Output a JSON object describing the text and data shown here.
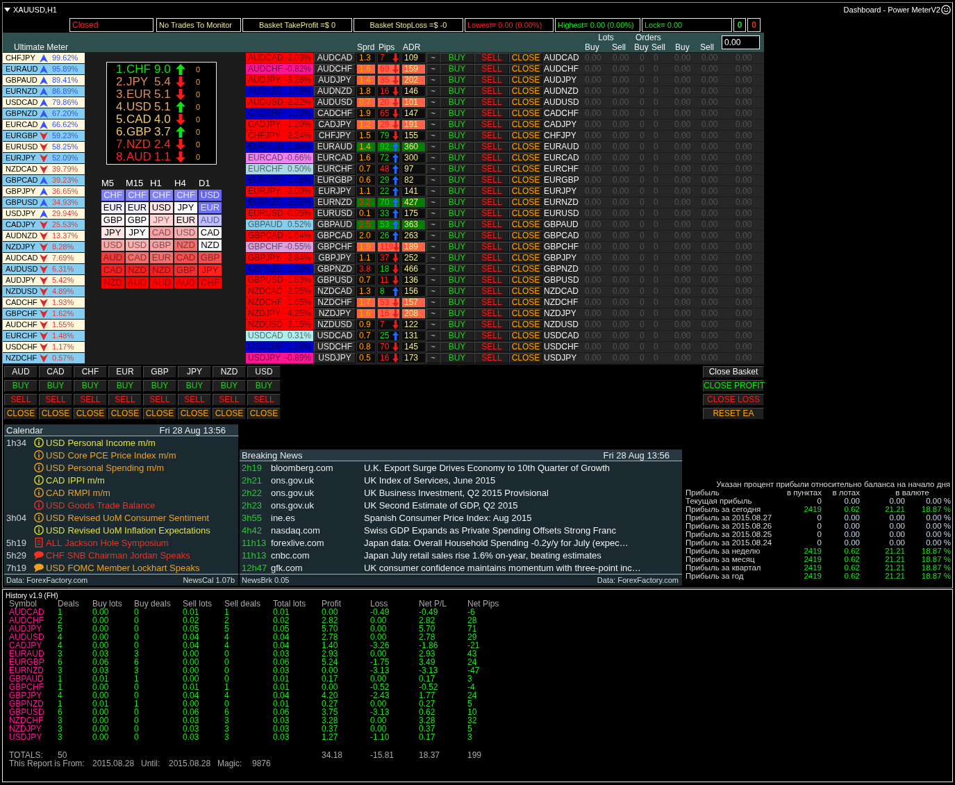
{
  "window": {
    "title": "XAUUSD,H1",
    "indicator": "Dashboard - Power MeterV2"
  },
  "status_boxes": [
    {
      "text": "Closed",
      "color": "#ff2020"
    },
    {
      "text": "No Trades To Monitor",
      "color": "#f0e68c"
    },
    {
      "text": "Basket TakeProfit =$ 0",
      "color": "#f0e68c"
    },
    {
      "text": "Basket StopLoss =$ -0",
      "color": "#f0e68c"
    },
    {
      "text": "Lowest= 0.00 (0.00%)",
      "color": "#ff2020"
    },
    {
      "text": "Highest= 0.00 (0.00%)",
      "color": "#20e020"
    },
    {
      "text": "Lock= 0.00",
      "color": "#20e020"
    },
    {
      "text": "0",
      "color": "#20e020"
    },
    {
      "text": "0",
      "color": "#ff2020"
    }
  ],
  "header": {
    "title": "Ultimate Meter",
    "columns": [
      "Sprd",
      "Pips",
      "ADR"
    ],
    "groups": [
      {
        "label": "Lots",
        "sub": [
          "Buy",
          "Sell"
        ]
      },
      {
        "label": "Orders",
        "sub": [
          "Buy",
          "Sell"
        ]
      }
    ],
    "extra": [
      "Buy",
      "Sell"
    ],
    "amount": "0.00"
  },
  "meter": [
    {
      "pair": "CHFJPY",
      "rising": true,
      "percent": "99.62%",
      "bullish": true
    },
    {
      "pair": "EURAUD",
      "rising": true,
      "percent": "95.89%",
      "bullish": true
    },
    {
      "pair": "GBPAUD",
      "rising": true,
      "percent": "89.41%",
      "bullish": true
    },
    {
      "pair": "EURNZD",
      "rising": true,
      "percent": "86.89%",
      "bullish": true
    },
    {
      "pair": "USDCAD",
      "rising": true,
      "percent": "79.86%",
      "bullish": true
    },
    {
      "pair": "GBPNZD",
      "rising": true,
      "percent": "67.20%",
      "bullish": true
    },
    {
      "pair": "EURCAD",
      "rising": true,
      "percent": "66.62%",
      "bullish": true
    },
    {
      "pair": "EURGBP",
      "rising": false,
      "percent": "59.23%",
      "bullish": true
    },
    {
      "pair": "EURUSD",
      "rising": false,
      "percent": "58.25%",
      "bullish": true
    },
    {
      "pair": "EURJPY",
      "rising": false,
      "percent": "52.09%",
      "bullish": true
    },
    {
      "pair": "NZDCAD",
      "rising": false,
      "percent": "39.79%",
      "bullish": false
    },
    {
      "pair": "GBPCAD",
      "rising": true,
      "percent": "39.23%",
      "bullish": false
    },
    {
      "pair": "GBPJPY",
      "rising": true,
      "percent": "36.65%",
      "bullish": false
    },
    {
      "pair": "GBPUSD",
      "rising": true,
      "percent": "34.93%",
      "bullish": false
    },
    {
      "pair": "USDJPY",
      "rising": true,
      "percent": "29.94%",
      "bullish": false
    },
    {
      "pair": "CADJPY",
      "rising": false,
      "percent": "25.53%",
      "bullish": false
    },
    {
      "pair": "AUDNZD",
      "rising": false,
      "percent": "13.37%",
      "bullish": false
    },
    {
      "pair": "NZDJPY",
      "rising": false,
      "percent": "8.28%",
      "bullish": false
    },
    {
      "pair": "AUDCAD",
      "rising": false,
      "percent": "7.69%",
      "bullish": false
    },
    {
      "pair": "AUDUSD",
      "rising": false,
      "percent": "6.31%",
      "bullish": false
    },
    {
      "pair": "AUDJPY",
      "rising": false,
      "percent": "5.42%",
      "bullish": false
    },
    {
      "pair": "NZDUSD",
      "rising": false,
      "percent": "4.89%",
      "bullish": false
    },
    {
      "pair": "CADCHF",
      "rising": false,
      "percent": "1.93%",
      "bullish": false
    },
    {
      "pair": "GBPCHF",
      "rising": false,
      "percent": "1.62%",
      "bullish": false
    },
    {
      "pair": "AUDCHF",
      "rising": false,
      "percent": "1.55%",
      "bullish": false
    },
    {
      "pair": "EURCHF",
      "rising": false,
      "percent": "1.48%",
      "bullish": false
    },
    {
      "pair": "USDCHF",
      "rising": false,
      "percent": "1.17%",
      "bullish": false
    },
    {
      "pair": "NZDCHF",
      "rising": false,
      "percent": "0.57%",
      "bullish": false
    }
  ],
  "strength": [
    {
      "rank": "1.",
      "currency": "CHF",
      "score": "9.0",
      "rising": true,
      "count": "0",
      "color": "#12e012"
    },
    {
      "rank": "2.",
      "currency": "JPY",
      "score": "5.4",
      "rising": false,
      "count": "0",
      "color": "#e08a50"
    },
    {
      "rank": "3.",
      "currency": "EUR",
      "score": "5.1",
      "rising": false,
      "count": "0",
      "color": "#e08a50"
    },
    {
      "rank": "4.",
      "currency": "USD",
      "score": "5.1",
      "rising": true,
      "count": "0",
      "color": "#e8a860"
    },
    {
      "rank": "5.",
      "currency": "CAD",
      "score": "4.0",
      "rising": false,
      "count": "0",
      "color": "#f0c860"
    },
    {
      "rank": "6.",
      "currency": "GBP",
      "score": "3.7",
      "rising": true,
      "count": "0",
      "color": "#f0c860"
    },
    {
      "rank": "7.",
      "currency": "NZD",
      "score": "2.4",
      "rising": false,
      "count": "0",
      "color": "#e83a10"
    },
    {
      "rank": "8.",
      "currency": "AUD",
      "score": "1.1",
      "rising": false,
      "count": "0",
      "color": "#ff2020"
    }
  ],
  "timeframes": [
    {
      "label": "M5",
      "cells": [
        {
          "currency": "CHF",
          "color": "#8080ff"
        },
        {
          "currency": "EUR",
          "color": "#f0f0ff"
        },
        {
          "currency": "GBP",
          "color": "#fff4f4"
        },
        {
          "currency": "JPY",
          "color": "#ffe4e4"
        },
        {
          "currency": "USD",
          "color": "#f4a8a8"
        },
        {
          "currency": "AUD",
          "color": "#ee3c3c"
        },
        {
          "currency": "CAD",
          "color": "#f42020"
        },
        {
          "currency": "NZD",
          "color": "#ff0000"
        }
      ]
    },
    {
      "label": "M15",
      "cells": [
        {
          "currency": "CHF",
          "color": "#8080ff"
        },
        {
          "currency": "EUR",
          "color": "#eef0ff"
        },
        {
          "currency": "GBP",
          "color": "#ffffff"
        },
        {
          "currency": "JPY",
          "color": "#fffafa"
        },
        {
          "currency": "USD",
          "color": "#f4b4b4"
        },
        {
          "currency": "CAD",
          "color": "#f07070"
        },
        {
          "currency": "NZD",
          "color": "#f42020"
        },
        {
          "currency": "AUD",
          "color": "#ff0000"
        }
      ]
    },
    {
      "label": "H1",
      "cells": [
        {
          "currency": "CHF",
          "color": "#8080ff"
        },
        {
          "currency": "USD",
          "color": "#ffe4e4"
        },
        {
          "currency": "JPY",
          "color": "#ffd4d4"
        },
        {
          "currency": "CAD",
          "color": "#f4a4a4"
        },
        {
          "currency": "GBP",
          "color": "#f4a4a4"
        },
        {
          "currency": "EUR",
          "color": "#f07070"
        },
        {
          "currency": "NZD",
          "color": "#f42020"
        },
        {
          "currency": "AUD",
          "color": "#ff0000"
        }
      ]
    },
    {
      "label": "H4",
      "cells": [
        {
          "currency": "CHF",
          "color": "#8080ff"
        },
        {
          "currency": "JPY",
          "color": "#ffffff"
        },
        {
          "currency": "EUR",
          "color": "#ffe4e4"
        },
        {
          "currency": "USD",
          "color": "#f4b0b0"
        },
        {
          "currency": "NZD",
          "color": "#f07070"
        },
        {
          "currency": "CAD",
          "color": "#f05050"
        },
        {
          "currency": "GBP",
          "color": "#f03030"
        },
        {
          "currency": "AUD",
          "color": "#ff0000"
        }
      ]
    },
    {
      "label": "D1",
      "cells": [
        {
          "currency": "USD",
          "color": "#6464ff"
        },
        {
          "currency": "EUR",
          "color": "#7070ff"
        },
        {
          "currency": "AUD",
          "color": "#c0c0ff"
        },
        {
          "currency": "CAD",
          "color": "#ffffff"
        },
        {
          "currency": "NZD",
          "color": "#f8f8ff"
        },
        {
          "currency": "GBP",
          "color": "#f05050"
        },
        {
          "currency": "JPY",
          "color": "#ff2020"
        },
        {
          "currency": "CHF",
          "color": "#ff0000"
        }
      ]
    }
  ],
  "pairs": [
    {
      "pair": "AUDCAD",
      "change": "-2.03%",
      "color": "#ff0000",
      "symbol": "AUDCAD",
      "stats": {
        "color": "#0c0c0c",
        "spread": {
          "text": "1.3",
          "wide": false
        },
        "pips": {
          "text": "7",
          "positive": false,
          "rising": false
        },
        "adr": "109"
      },
      "actions": [
        "~",
        "BUY",
        "SELL",
        "CLOSE"
      ],
      "label": "AUDCAD",
      "values": [
        "0.00",
        "0.00",
        "0",
        "0",
        "0.00",
        "0.00",
        "0.00"
      ]
    },
    {
      "pair": "AUDCHF",
      "change": "-0.82%",
      "color": "#ff1493",
      "symbol": "AUDCHF",
      "stats": {
        "color": "#ff6347",
        "spread": {
          "text": "1.6",
          "wide": false
        },
        "pips": {
          "text": "69",
          "positive": false,
          "rising": false
        },
        "adr": "159"
      },
      "actions": [
        "~",
        "BUY",
        "SELL",
        "CLOSE"
      ],
      "label": "AUDCHF",
      "values": [
        "0.00",
        "0.00",
        "0",
        "0",
        "0.00",
        "0.00",
        "0.00"
      ]
    },
    {
      "pair": "AUDJPY",
      "change": "-3.26%",
      "color": "#ff0000",
      "symbol": "AUDJPY",
      "stats": {
        "color": "#ff6347",
        "spread": {
          "text": "1.4",
          "wide": false
        },
        "pips": {
          "text": "35",
          "positive": false,
          "rising": false
        },
        "adr": "202"
      },
      "actions": [
        "~",
        "BUY",
        "SELL",
        "CLOSE"
      ],
      "label": "AUDJPY",
      "values": [
        "0.00",
        "0.00",
        "0",
        "0",
        "0.00",
        "0.00",
        "0.00"
      ]
    },
    {
      "pair": "AUDNZD",
      "change": "1.09%",
      "color": "#0000cd",
      "symbol": "AUDNZD",
      "stats": {
        "color": "#0c0c0c",
        "spread": {
          "text": "1.8",
          "wide": false
        },
        "pips": {
          "text": "16",
          "positive": false,
          "rising": false
        },
        "adr": "146"
      },
      "actions": [
        "~",
        "BUY",
        "SELL",
        "CLOSE"
      ],
      "label": "AUDNZD",
      "values": [
        "0.00",
        "0.00",
        "0",
        "0",
        "0.00",
        "0.00",
        "0.00"
      ]
    },
    {
      "pair": "AUDUSD",
      "change": "-2.22%",
      "color": "#ff0000",
      "symbol": "AUDUSD",
      "stats": {
        "color": "#ff6347",
        "spread": {
          "text": "0.7",
          "wide": false
        },
        "pips": {
          "text": "20",
          "positive": false,
          "rising": false
        },
        "adr": "101"
      },
      "actions": [
        "~",
        "BUY",
        "SELL",
        "CLOSE"
      ],
      "label": "AUDUSD",
      "values": [
        "0.00",
        "0.00",
        "0",
        "0",
        "0.00",
        "0.00",
        "0.00"
      ]
    },
    {
      "pair": "CADCHF",
      "change": "1.10%",
      "color": "#0000cd",
      "symbol": "CADCHF",
      "stats": {
        "color": "#0c0c0c",
        "spread": {
          "text": "1.9",
          "wide": false
        },
        "pips": {
          "text": "65",
          "positive": false,
          "rising": false
        },
        "adr": "147"
      },
      "actions": [
        "~",
        "BUY",
        "SELL",
        "CLOSE"
      ],
      "label": "CADCHF",
      "values": [
        "0.00",
        "0.00",
        "0",
        "0",
        "0.00",
        "0.00",
        "0.00"
      ]
    },
    {
      "pair": "CADJPY",
      "change": "-1.20%",
      "color": "#ff0000",
      "symbol": "CADJPY",
      "stats": {
        "color": "#ff6347",
        "spread": {
          "text": "1.2",
          "wide": false
        },
        "pips": {
          "text": "29",
          "positive": false,
          "rising": false
        },
        "adr": "191"
      },
      "actions": [
        "~",
        "BUY",
        "SELL",
        "CLOSE"
      ],
      "label": "CADJPY",
      "values": [
        "0.00",
        "0.00",
        "0",
        "0",
        "0.00",
        "0.00",
        "0.00"
      ]
    },
    {
      "pair": "CHFJPY",
      "change": "-2.24%",
      "color": "#ff0000",
      "symbol": "CHFJPY",
      "stats": {
        "color": "#0c0c0c",
        "spread": {
          "text": "1.5",
          "wide": false
        },
        "pips": {
          "text": "79",
          "positive": true,
          "rising": false
        },
        "adr": "155"
      },
      "actions": [
        "~",
        "BUY",
        "SELL",
        "CLOSE"
      ],
      "label": "CHFJPY",
      "values": [
        "0.00",
        "0.00",
        "0",
        "0",
        "0.00",
        "0.00",
        "0.00"
      ]
    },
    {
      "pair": "EURAUD",
      "change": "1.44%",
      "color": "#0000cd",
      "symbol": "EURAUD",
      "stats": {
        "color": "#008000",
        "spread": {
          "text": "1.4",
          "wide": false
        },
        "pips": {
          "text": "92",
          "positive": true,
          "rising": true
        },
        "adr": "360"
      },
      "actions": [
        "~",
        "BUY",
        "SELL",
        "CLOSE"
      ],
      "label": "EURAUD",
      "values": [
        "0.00",
        "0.00",
        "0",
        "0",
        "0.00",
        "0.00",
        "0.00"
      ]
    },
    {
      "pair": "EURCAD",
      "change": "-0.66%",
      "color": "#ee82ee",
      "symbol": "EURCAD",
      "stats": {
        "color": "#0c0c0c",
        "spread": {
          "text": "1.6",
          "wide": false
        },
        "pips": {
          "text": "72",
          "positive": true,
          "rising": true
        },
        "adr": "300"
      },
      "actions": [
        "~",
        "BUY",
        "SELL",
        "CLOSE"
      ],
      "label": "EURCAD",
      "values": [
        "0.00",
        "0.00",
        "0",
        "0",
        "0.00",
        "0.00",
        "0.00"
      ]
    },
    {
      "pair": "EURCHF",
      "change": "0.50%",
      "color": "#add8e6",
      "symbol": "EURCHF",
      "stats": {
        "color": "#0c0c0c",
        "spread": {
          "text": "0.7",
          "wide": false
        },
        "pips": {
          "text": "48",
          "positive": false,
          "rising": true
        },
        "adr": "97"
      },
      "actions": [
        "~",
        "BUY",
        "SELL",
        "CLOSE"
      ],
      "label": "EURCHF",
      "values": [
        "0.00",
        "0.00",
        "0",
        "0",
        "0.00",
        "0.00",
        "0.00"
      ]
    },
    {
      "pair": "EURGBP",
      "change": "1.08%",
      "color": "#0000cd",
      "symbol": "EURGBP",
      "stats": {
        "color": "#0c0c0c",
        "spread": {
          "text": "0.6",
          "wide": false
        },
        "pips": {
          "text": "29",
          "positive": true,
          "rising": true
        },
        "adr": "82"
      },
      "actions": [
        "~",
        "BUY",
        "SELL",
        "CLOSE"
      ],
      "label": "EURGBP",
      "values": [
        "0.00",
        "0.00",
        "0",
        "0",
        "0.00",
        "0.00",
        "0.00"
      ]
    },
    {
      "pair": "EURJPY",
      "change": "-2.00%",
      "color": "#ff0000",
      "symbol": "EURJPY",
      "stats": {
        "color": "#0c0c0c",
        "spread": {
          "text": "1.1",
          "wide": false
        },
        "pips": {
          "text": "22",
          "positive": true,
          "rising": true
        },
        "adr": "141"
      },
      "actions": [
        "~",
        "BUY",
        "SELL",
        "CLOSE"
      ],
      "label": "EURJPY",
      "values": [
        "0.00",
        "0.00",
        "0",
        "0",
        "0.00",
        "0.00",
        "0.00"
      ]
    },
    {
      "pair": "EURNZD",
      "change": "2.52%",
      "color": "#0000cd",
      "symbol": "EURNZD",
      "stats": {
        "color": "#008000",
        "spread": {
          "text": "3.2",
          "wide": true
        },
        "pips": {
          "text": "70",
          "positive": true,
          "rising": true
        },
        "adr": "427"
      },
      "actions": [
        "~",
        "BUY",
        "SELL",
        "CLOSE"
      ],
      "label": "EURNZD",
      "values": [
        "0.00",
        "0.00",
        "0",
        "0",
        "0.00",
        "0.00",
        "0.00"
      ]
    },
    {
      "pair": "EURUSD",
      "change": "-0.95%",
      "color": "#ff0000",
      "symbol": "EURUSD",
      "stats": {
        "color": "#0c0c0c",
        "spread": {
          "text": "0.1",
          "wide": false
        },
        "pips": {
          "text": "33",
          "positive": true,
          "rising": true
        },
        "adr": "175"
      },
      "actions": [
        "~",
        "BUY",
        "SELL",
        "CLOSE"
      ],
      "label": "EURUSD",
      "values": [
        "0.00",
        "0.00",
        "0",
        "0",
        "0.00",
        "0.00",
        "0.00"
      ]
    },
    {
      "pair": "GBPAUD",
      "change": "0.52%",
      "color": "#87ceeb",
      "symbol": "GBPAUD",
      "stats": {
        "color": "#008000",
        "spread": {
          "text": "2.5",
          "wide": true
        },
        "pips": {
          "text": "53",
          "positive": true,
          "rising": true
        },
        "adr": "363"
      },
      "actions": [
        "~",
        "BUY",
        "SELL",
        "CLOSE"
      ],
      "label": "GBPAUD",
      "values": [
        "0.00",
        "0.00",
        "0",
        "0",
        "0.00",
        "0.00",
        "0.00"
      ]
    },
    {
      "pair": "GBPCAD",
      "change": "-1.64%",
      "color": "#ff0000",
      "symbol": "GBPCAD",
      "stats": {
        "color": "#0c0c0c",
        "spread": {
          "text": "2.0",
          "wide": false
        },
        "pips": {
          "text": "26",
          "positive": true,
          "rising": true
        },
        "adr": "263"
      },
      "actions": [
        "~",
        "BUY",
        "SELL",
        "CLOSE"
      ],
      "label": "GBPCAD",
      "values": [
        "0.00",
        "0.00",
        "0",
        "0",
        "0.00",
        "0.00",
        "0.00"
      ]
    },
    {
      "pair": "GBPCHF",
      "change": "-0.55%",
      "color": "#dda0dd",
      "symbol": "GBPCHF",
      "stats": {
        "color": "#ff6347",
        "spread": {
          "text": "1.9",
          "wide": false
        },
        "pips": {
          "text": "119",
          "positive": false,
          "rising": false
        },
        "adr": "189"
      },
      "actions": [
        "~",
        "BUY",
        "SELL",
        "CLOSE"
      ],
      "label": "GBPCHF",
      "values": [
        "0.00",
        "0.00",
        "0",
        "0",
        "0.00",
        "0.00",
        "0.00"
      ]
    },
    {
      "pair": "GBPJPY",
      "change": "-2.84%",
      "color": "#ff0000",
      "symbol": "GBPJPY",
      "stats": {
        "color": "#0c0c0c",
        "spread": {
          "text": "1.1",
          "wide": false
        },
        "pips": {
          "text": "37",
          "positive": false,
          "rising": false
        },
        "adr": "252"
      },
      "actions": [
        "~",
        "BUY",
        "SELL",
        "CLOSE"
      ],
      "label": "GBPJPY",
      "values": [
        "0.00",
        "0.00",
        "0",
        "0",
        "0.00",
        "0.00",
        "0.00"
      ]
    },
    {
      "pair": "GBPNZD",
      "change": "1.53%",
      "color": "#0000cd",
      "symbol": "GBPNZD",
      "stats": {
        "color": "#0c0c0c",
        "spread": {
          "text": "3.8",
          "wide": true
        },
        "pips": {
          "text": "18",
          "positive": true,
          "rising": false
        },
        "adr": "466"
      },
      "actions": [
        "~",
        "BUY",
        "SELL",
        "CLOSE"
      ],
      "label": "GBPNZD",
      "values": [
        "0.00",
        "0.00",
        "0",
        "0",
        "0.00",
        "0.00",
        "0.00"
      ]
    },
    {
      "pair": "GBPUSD",
      "change": "-1.83%",
      "color": "#ff0000",
      "symbol": "GBPUSD",
      "stats": {
        "color": "#0c0c0c",
        "spread": {
          "text": "0.7",
          "wide": false
        },
        "pips": {
          "text": "11",
          "positive": false,
          "rising": false
        },
        "adr": "136"
      },
      "actions": [
        "~",
        "BUY",
        "SELL",
        "CLOSE"
      ],
      "label": "GBPUSD",
      "values": [
        "0.00",
        "0.00",
        "0",
        "0",
        "0.00",
        "0.00",
        "0.00"
      ]
    },
    {
      "pair": "NZDCAD",
      "change": "-2.95%",
      "color": "#ff0000",
      "symbol": "NZDCAD",
      "stats": {
        "color": "#0c0c0c",
        "spread": {
          "text": "1.3",
          "wide": false
        },
        "pips": {
          "text": "8",
          "positive": true,
          "rising": true
        },
        "adr": "156"
      },
      "actions": [
        "~",
        "BUY",
        "SELL",
        "CLOSE"
      ],
      "label": "NZDCAD",
      "values": [
        "0.00",
        "0.00",
        "0",
        "0",
        "0.00",
        "0.00",
        "0.00"
      ]
    },
    {
      "pair": "NZDCHF",
      "change": "-1.65%",
      "color": "#ff0000",
      "symbol": "NZDCHF",
      "stats": {
        "color": "#ff6347",
        "spread": {
          "text": "1.7",
          "wide": false
        },
        "pips": {
          "text": "53",
          "positive": false,
          "rising": false
        },
        "adr": "157"
      },
      "actions": [
        "~",
        "BUY",
        "SELL",
        "CLOSE"
      ],
      "label": "NZDCHF",
      "values": [
        "0.00",
        "0.00",
        "0",
        "0",
        "0.00",
        "0.00",
        "0.00"
      ]
    },
    {
      "pair": "NZDJPY",
      "change": "-4.25%",
      "color": "#ff0000",
      "symbol": "NZDJPY",
      "stats": {
        "color": "#ff6347",
        "spread": {
          "text": "1.6",
          "wide": false
        },
        "pips": {
          "text": "16",
          "positive": false,
          "rising": false
        },
        "adr": "208"
      },
      "actions": [
        "~",
        "BUY",
        "SELL",
        "CLOSE"
      ],
      "label": "NZDJPY",
      "values": [
        "0.00",
        "0.00",
        "0",
        "0",
        "0.00",
        "0.00",
        "0.00"
      ]
    },
    {
      "pair": "NZDUSD",
      "change": "-3.15%",
      "color": "#ff0000",
      "symbol": "NZDUSD",
      "stats": {
        "color": "#0c0c0c",
        "spread": {
          "text": "0.9",
          "wide": false
        },
        "pips": {
          "text": "7",
          "positive": false,
          "rising": false
        },
        "adr": "122"
      },
      "actions": [
        "~",
        "BUY",
        "SELL",
        "CLOSE"
      ],
      "label": "NZDUSD",
      "values": [
        "0.00",
        "0.00",
        "0",
        "0",
        "0.00",
        "0.00",
        "0.00"
      ]
    },
    {
      "pair": "USDCAD",
      "change": "0.31%",
      "color": "#afeeee",
      "symbol": "USDCAD",
      "stats": {
        "color": "#0c0c0c",
        "spread": {
          "text": "0.7",
          "wide": false
        },
        "pips": {
          "text": "25",
          "positive": true,
          "rising": true
        },
        "adr": "131"
      },
      "actions": [
        "~",
        "BUY",
        "SELL",
        "CLOSE"
      ],
      "label": "USDCAD",
      "values": [
        "0.00",
        "0.00",
        "0",
        "0",
        "0.00",
        "0.00",
        "0.00"
      ]
    },
    {
      "pair": "USDCHF",
      "change": "1.39%",
      "color": "#0000cd",
      "symbol": "USDCHF",
      "stats": {
        "color": "#0c0c0c",
        "spread": {
          "text": "0.8",
          "wide": false
        },
        "pips": {
          "text": "70",
          "positive": false,
          "rising": false
        },
        "adr": "145"
      },
      "actions": [
        "~",
        "BUY",
        "SELL",
        "CLOSE"
      ],
      "label": "USDCHF",
      "values": [
        "0.00",
        "0.00",
        "0",
        "0",
        "0.00",
        "0.00",
        "0.00"
      ]
    },
    {
      "pair": "USDJPY",
      "change": "-0.89%",
      "color": "#ff1493",
      "symbol": "USDJPY",
      "stats": {
        "color": "#0c0c0c",
        "spread": {
          "text": "0.5",
          "wide": false
        },
        "pips": {
          "text": "16",
          "positive": false,
          "rising": false
        },
        "adr": "173"
      },
      "actions": [
        "~",
        "BUY",
        "SELL",
        "CLOSE"
      ],
      "label": "USDJPY",
      "values": [
        "0.00",
        "0.00",
        "0",
        "0",
        "0.00",
        "0.00",
        "0.00"
      ]
    }
  ],
  "basket": [
    {
      "currency": "AUD",
      "actions": [
        "BUY",
        "SELL",
        "CLOSE"
      ]
    },
    {
      "currency": "CAD",
      "actions": [
        "BUY",
        "SELL",
        "CLOSE"
      ]
    },
    {
      "currency": "CHF",
      "actions": [
        "BUY",
        "SELL",
        "CLOSE"
      ]
    },
    {
      "currency": "EUR",
      "actions": [
        "BUY",
        "SELL",
        "CLOSE"
      ]
    },
    {
      "currency": "GBP",
      "actions": [
        "BUY",
        "SELL",
        "CLOSE"
      ]
    },
    {
      "currency": "JPY",
      "actions": [
        "BUY",
        "SELL",
        "CLOSE"
      ]
    },
    {
      "currency": "NZD",
      "actions": [
        "BUY",
        "SELL",
        "CLOSE"
      ]
    },
    {
      "currency": "USD",
      "actions": [
        "BUY",
        "SELL",
        "CLOSE"
      ]
    }
  ],
  "basket_actions": [
    {
      "label": "Close Basket",
      "kind": "basket"
    },
    {
      "label": "CLOSE PROFIT",
      "kind": "profit"
    },
    {
      "label": "CLOSE LOSS",
      "kind": "loss"
    },
    {
      "label": "RESET EA",
      "kind": "reset"
    }
  ],
  "calendar": {
    "title": "Calendar",
    "datetime": "Fri 28 Aug 13:56",
    "events": [
      {
        "time": "1h34",
        "kind": "info",
        "color": "#e0e030",
        "currency": "USD",
        "title": "Personal Income m/m"
      },
      {
        "kind": "info",
        "color": "#f0a020",
        "currency": "USD",
        "title": "Core PCE Price Index m/m"
      },
      {
        "kind": "info",
        "color": "#f0a020",
        "currency": "USD",
        "title": "Personal Spending m/m"
      },
      {
        "kind": "info",
        "color": "#e0e030",
        "currency": "CAD",
        "title": "IPPI m/m"
      },
      {
        "kind": "info",
        "color": "#f0a020",
        "currency": "CAD",
        "title": "RMPI m/m"
      },
      {
        "kind": "info",
        "color": "#f03020",
        "currency": "USD",
        "title": "Goods Trade Balance"
      },
      {
        "time": "3h04",
        "kind": "info",
        "color": "#f0a020",
        "currency": "USD",
        "title": "Revised UoM Consumer Sentiment"
      },
      {
        "kind": "info",
        "color": "#e0e030",
        "currency": "USD",
        "title": "Revised UoM Inflation Expectations"
      },
      {
        "time": "5h19",
        "kind": "document",
        "color": "#f03020",
        "currency": "ALL",
        "title": "Jackson Hole Symposium"
      },
      {
        "time": "5h29",
        "kind": "speech",
        "color": "#f03020",
        "currency": "CHF",
        "title": "SNB Chairman Jordan Speaks"
      },
      {
        "time": "7h19",
        "kind": "speech",
        "color": "#f0a020",
        "currency": "USD",
        "title": "FOMC Member Lockhart Speaks"
      }
    ],
    "source": "Data: ForexFactory.com",
    "version": "NewsCal 1.07b"
  },
  "news": {
    "title": "Breaking News",
    "datetime": "Fri 28 Aug 13:56",
    "items": [
      {
        "age": "2h19",
        "source": "bloomberg.com",
        "headline": "U.K. Export Surge Drives Economy to 10th Quarter of Growth"
      },
      {
        "age": "2h21",
        "source": "ons.gov.uk",
        "headline": "UK Index of Services, June 2015"
      },
      {
        "age": "2h22",
        "source": "ons.gov.uk",
        "headline": "UK Business Investment, Q2 2015 Provisional"
      },
      {
        "age": "2h23",
        "source": "ons.gov.uk",
        "headline": "UK Second Estimate of GDP, Q2 2015"
      },
      {
        "age": "3h55",
        "source": "ine.es",
        "headline": "Spanish Consumer Price Index: Aug 2015"
      },
      {
        "age": "4h42",
        "source": "nasdaq.com",
        "headline": "Swiss GDP Expands as Private Spending Offsets Strong Franc"
      },
      {
        "age": "11h13",
        "source": "forexlive.com",
        "headline": "Japan data: Overall Household Spending -0.2y/y for July (expec…"
      },
      {
        "age": "11h13",
        "source": "cnbc.com",
        "headline": "Japan July retail sales rise 1.6% on-year, beating estimates"
      },
      {
        "age": "12h47",
        "source": "gfk.com",
        "headline": "UK consumer confidence maintains momentum with three-point inc…"
      }
    ],
    "version": "NewsBrk 0.05",
    "source": "Data: ForexFactory.com"
  },
  "profit_report": {
    "note": "Указан процент прибыли относительно баланса на начало дня",
    "columns": [
      "Прибыль",
      "в пунктах",
      "в лотах",
      "в валюте"
    ],
    "rows": [
      {
        "label": "Текущая прибыль",
        "values": [
          "0",
          "0.00",
          "0.00",
          "0.00 %"
        ],
        "positive": false
      },
      {
        "label": "Прибыль за сегодня",
        "values": [
          "2419",
          "0.62",
          "21.21",
          "18.87 %"
        ],
        "positive": true
      },
      {
        "label": "Прибыль за 2015.08.27",
        "values": [
          "0",
          "0.00",
          "0.00",
          "0.00 %"
        ],
        "positive": false
      },
      {
        "label": "Прибыль за 2015.08.26",
        "values": [
          "0",
          "0.00",
          "0.00",
          "0.00 %"
        ],
        "positive": false
      },
      {
        "label": "Прибыль за 2015.08.25",
        "values": [
          "0",
          "0.00",
          "0.00",
          "0.00 %"
        ],
        "positive": false
      },
      {
        "label": "Прибыль за 2015.08.24",
        "values": [
          "0",
          "0.00",
          "0.00",
          "0.00 %"
        ],
        "positive": false
      },
      {
        "label": "Прибыль за неделю",
        "values": [
          "2419",
          "0.62",
          "21.21",
          "18.87 %"
        ],
        "positive": true
      },
      {
        "label": "Прибыль за месяц",
        "values": [
          "2419",
          "0.62",
          "21.21",
          "18.87 %"
        ],
        "positive": true
      },
      {
        "label": "Прибыль за квартал",
        "values": [
          "2419",
          "0.62",
          "21.21",
          "18.87 %"
        ],
        "positive": true
      },
      {
        "label": "Прибыль за год",
        "values": [
          "2419",
          "0.62",
          "21.21",
          "18.87 %"
        ],
        "positive": true
      }
    ]
  },
  "history": {
    "title": "History v1.9 (FH)",
    "columns": [
      "Symbol",
      "Deals",
      "Buy lots",
      "Buy deals",
      "Sell lots",
      "Sell deals",
      "Total lots",
      "Profit",
      "Loss",
      "Net P/L",
      "Net Pips"
    ],
    "rows": [
      {
        "symbol": "AUDCAD",
        "values": [
          "1",
          "0.00",
          "0",
          "0.01",
          "1",
          "0.01",
          "0.00",
          "-0.49",
          "-0.49",
          "-6"
        ]
      },
      {
        "symbol": "AUDCHF",
        "values": [
          "2",
          "0.00",
          "0",
          "0.02",
          "2",
          "0.02",
          "2.82",
          "0.00",
          "2.82",
          "28"
        ]
      },
      {
        "symbol": "AUDJPY",
        "values": [
          "5",
          "0.00",
          "0",
          "0.05",
          "5",
          "0.05",
          "5.70",
          "0.00",
          "5.70",
          "71"
        ]
      },
      {
        "symbol": "AUDUSD",
        "values": [
          "4",
          "0.00",
          "0",
          "0.04",
          "4",
          "0.04",
          "2.78",
          "0.00",
          "2.78",
          "29"
        ]
      },
      {
        "symbol": "CADJPY",
        "values": [
          "4",
          "0.00",
          "0",
          "0.04",
          "4",
          "0.04",
          "1.40",
          "-3.26",
          "-1.86",
          "-21"
        ]
      },
      {
        "symbol": "EURAUD",
        "values": [
          "3",
          "0.03",
          "3",
          "0.00",
          "0",
          "0.03",
          "2.93",
          "0.00",
          "2.93",
          "43"
        ]
      },
      {
        "symbol": "EURGBP",
        "values": [
          "6",
          "0.06",
          "6",
          "0.00",
          "0",
          "0.06",
          "5.24",
          "-1.75",
          "3.49",
          "24"
        ]
      },
      {
        "symbol": "EURNZD",
        "values": [
          "3",
          "0.03",
          "3",
          "0.00",
          "0",
          "0.03",
          "0.00",
          "-3.13",
          "-3.13",
          "-47"
        ]
      },
      {
        "symbol": "GBPAUD",
        "values": [
          "1",
          "0.01",
          "1",
          "0.00",
          "0",
          "0.01",
          "0.17",
          "0.00",
          "0.17",
          "3"
        ]
      },
      {
        "symbol": "GBPCHF",
        "values": [
          "1",
          "0.00",
          "0",
          "0.01",
          "1",
          "0.01",
          "0.00",
          "-0.52",
          "-0.52",
          "-4"
        ]
      },
      {
        "symbol": "GBPJPY",
        "values": [
          "4",
          "0.00",
          "0",
          "0.04",
          "4",
          "0.04",
          "4.20",
          "-2.43",
          "1.77",
          "24"
        ]
      },
      {
        "symbol": "GBPNZD",
        "values": [
          "1",
          "0.01",
          "1",
          "0.00",
          "0",
          "0.01",
          "0.27",
          "0.00",
          "0.27",
          "5"
        ]
      },
      {
        "symbol": "GBPUSD",
        "values": [
          "6",
          "0.00",
          "0",
          "0.06",
          "6",
          "0.06",
          "3.75",
          "-3.13",
          "0.62",
          "10"
        ]
      },
      {
        "symbol": "NZDCHF",
        "values": [
          "3",
          "0.00",
          "0",
          "0.03",
          "3",
          "0.03",
          "3.28",
          "0.00",
          "3.28",
          "32"
        ]
      },
      {
        "symbol": "NZDJPY",
        "values": [
          "3",
          "0.00",
          "0",
          "0.03",
          "3",
          "0.03",
          "0.37",
          "0.00",
          "0.37",
          "5"
        ]
      },
      {
        "symbol": "USDJPY",
        "values": [
          "3",
          "0.00",
          "0",
          "0.03",
          "3",
          "0.03",
          "1.27",
          "-1.10",
          "0.17",
          "3"
        ]
      }
    ],
    "totals": {
      "label": "TOTALS:",
      "deals": "50",
      "profit": "34.18",
      "loss": "-15.81",
      "net_pl": "18.37",
      "net_pips": "199"
    },
    "report": [
      {
        "label": "This Report is From:",
        "value": "2015.08.28"
      },
      {
        "label": "Until:",
        "value": "2015.08.28"
      },
      {
        "label": "Magic:",
        "value": "9876"
      }
    ]
  }
}
